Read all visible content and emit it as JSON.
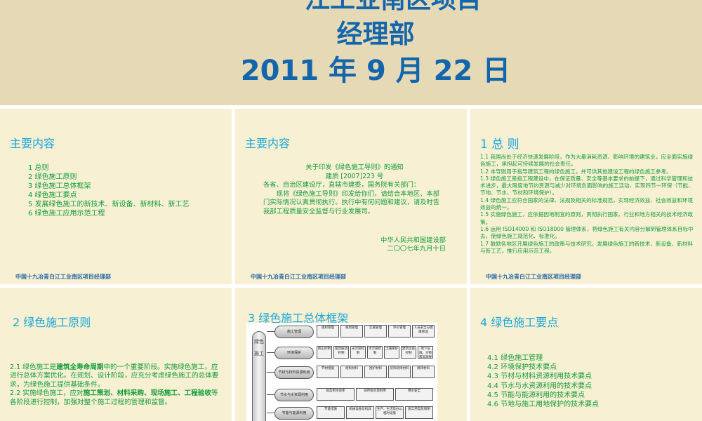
{
  "banner": {
    "line1": "江工业南区项目",
    "line2": "经理部",
    "line3": "2011 年 9 月 22 日"
  },
  "footer_text": "中国十九冶青白江工业南区项目经理部",
  "slide1": {
    "title": "主要内容",
    "items": [
      "1  总则",
      "2  绿色施工原则",
      "3  绿色施工总体框架",
      "4  绿色施工要点",
      "5  发展绿色施工的新技术、新设备、新材料、新工艺",
      "6  绿色施工应用示范工程"
    ]
  },
  "slide2": {
    "title": "主要内容",
    "heading": "关于印发《绿色施工导则》的通知",
    "doc_no": "建质 [2007]223 号",
    "addressee": "各省、自治区建设厅，直辖市建委，国务院有关部门：",
    "body": "现将《绿色施工导则》印发给你们，请结合本地区、本部门实际情况认真贯彻执行。执行中有何问题和建议，请及时告我部工程质量安全监督与行业发展司。",
    "signer": "中华人民共和国建设部",
    "date": "二〇〇七年九月十日"
  },
  "slide3": {
    "title": "1  总 则",
    "paras": [
      "1.1  我国尚处于经济快速发展阶段，作为大量消耗资源、影响环境的建筑业，应全面实施绿色施工，承担起可持续发展的社会责任。",
      "1.2  本导则用于指导建筑工程的绿色施工，并可供其他建设工程的绿色施工参考。",
      "1.3  绿色施工是指工程建设中，在保证质量、安全等基本要求的前提下，通过科学管理和技术进步，最大限度地节约资源与减少对环境负面影响的施工活动，实现四节一环保（节能、节地、节水、节材和环境保护）。",
      "1.4  绿色施工应符合国家的法律、法规及相关的标准规范，实现经济效益、社会效益和环境效益的统一。",
      "1.5  实施绿色施工，应依据因地制宜的原则，贯彻执行国家、行业和地方相关的技术经济政策。",
      "1.6  运用 ISO14000 和 ISO18000 管理体系，将绿色施工有关内容分解到管理体系目标中去，使绿色施工规范化、标准化。",
      "1.7  鼓励各地区开展绿色施工的政策与技术研究，发展绿色施工的新技术、新设备、新材料与新工艺，推行应用示范工程。"
    ]
  },
  "slide4": {
    "title": "2 绿色施工原则",
    "p1_a": "2.1  绿色施工是",
    "p1_b": "建筑全寿命周期",
    "p1_c": "中的一个重要阶段。实施绿色施工，应进行总体方案优化。在规划、设计阶段，应充分考虑绿色施工的总体要求，为绿色施工提供基础条件。",
    "p2_a": "2.2  实施绿色施工，应对",
    "p2_b": "施工策划、材料采购、现场施工、工程验收",
    "p2_c": "等各阶段进行控制，加强对整个施工过程的管理和监督。"
  },
  "slide5": {
    "title": "3 绿色施工总体框架",
    "diagram": {
      "column": "绿色施工",
      "nodes": [
        "施工管理",
        "环境保护",
        "节材与材料资源利用",
        "节水与水资源利用",
        "节能与能源利用"
      ],
      "rows": [
        [
          "组织管理",
          "规划管理",
          "实施管理",
          "评价管理",
          "人员安全与健康管理"
        ],
        [
          "扬尘控制",
          "噪音振动控制",
          "光污染控制",
          "水污染控制",
          "土壤保护",
          "建筑垃圾控制",
          "地下设施、文物和资源保护"
        ],
        [
          "节材措施",
          "结构材料",
          "围护材料",
          "装饰装修材料",
          "周转材料"
        ],
        [
          "提高用水效率",
          "非传统水源利用",
          "用水安全"
        ],
        [
          "节能措施",
          "机械设备与机具",
          "生产、生活及办公临时设施",
          "施工用电及照明"
        ]
      ]
    }
  },
  "slide6": {
    "title": "4 绿色施工要点",
    "items": [
      "4.1  绿色施工管理",
      "4.2  环境保护技术要点",
      "4.3  节材与材料资源利用技术要点",
      "4.4  节水与水资源利用的技术要点",
      "4.5  节能与能源利用的技术要点",
      "4.6  节地与施工用地保护的技术要点"
    ]
  }
}
